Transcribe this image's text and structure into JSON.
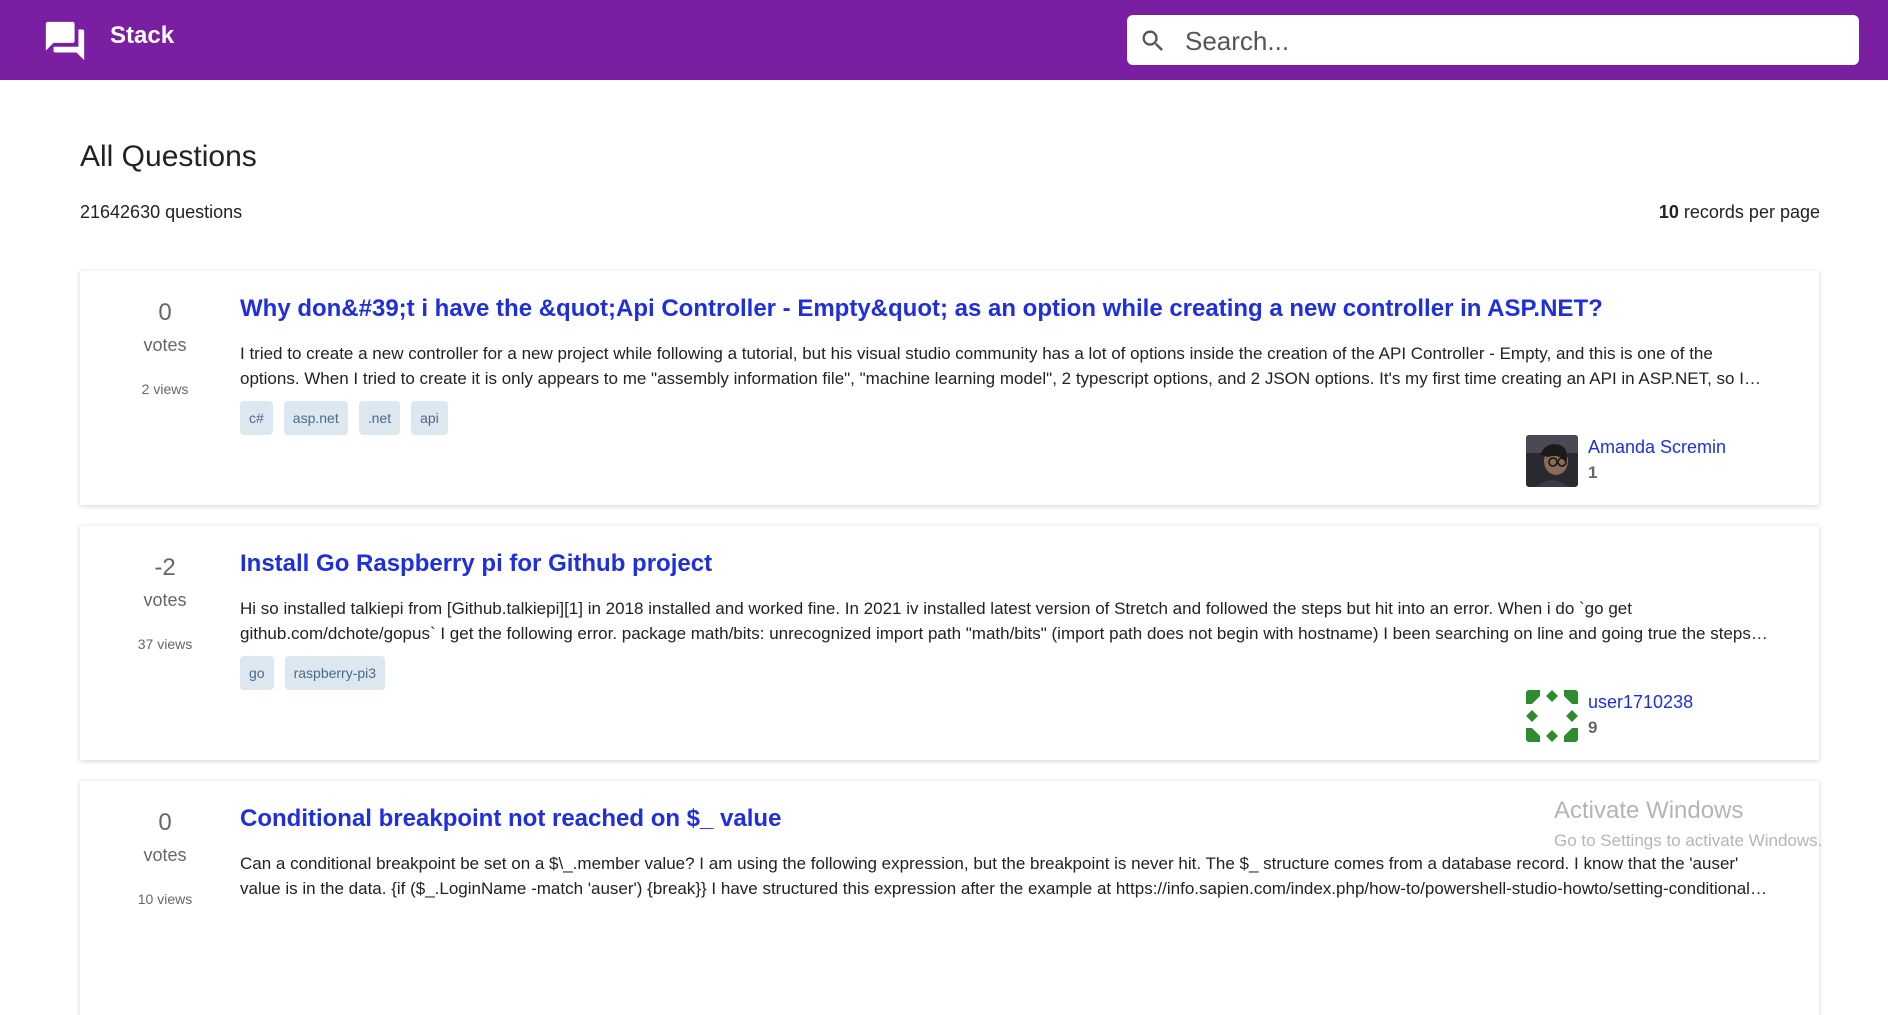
{
  "header": {
    "brand": "Stack",
    "search_placeholder": "Search..."
  },
  "main": {
    "title": "All Questions",
    "count_text": "21642630 questions",
    "per_page_value": "10",
    "per_page_suffix": " records per page"
  },
  "questions": [
    {
      "votes": "0",
      "votes_label": "votes",
      "views": "2 views",
      "title": "Why don&#39;t i have the &quot;Api Controller - Empty&quot; as an option while creating a new controller in ASP.NET?",
      "excerpt": "I tried to create a new controller for a new project while following a tutorial, but his visual studio community has a lot of options inside the creation of the API Controller - Empty, and this is one of the options. When I tried to create it is only appears to me \"assembly information file\", \"machine learning model\", 2 typescript options, and 2 JSON options. It's my first time creating an API in ASP.NET, so I don't know what to do.",
      "tags": [
        "c#",
        "asp.net",
        ".net",
        "api"
      ],
      "user": {
        "name": "Amanda Scremin",
        "reputation": "1"
      }
    },
    {
      "votes": "-2",
      "votes_label": "votes",
      "views": "37 views",
      "title": "Install Go Raspberry pi for Github project",
      "excerpt": "Hi so installed talkiepi from [Github.talkiepi][1] in 2018 installed and worked fine. In 2021 iv installed latest version of Stretch and followed the steps but hit into an error. When i do `go get github.com/dchote/gopus` I get the following error. package math/bits: unrecognized import path \"math/bits\" (import path does not begin with hostname) I been searching on line and going true the steps again and again.",
      "tags": [
        "go",
        "raspberry-pi3"
      ],
      "user": {
        "name": "user1710238",
        "reputation": "9"
      }
    },
    {
      "votes": "0",
      "votes_label": "votes",
      "views": "10 views",
      "title": "Conditional breakpoint not reached on $_ value",
      "excerpt": "Can a conditional breakpoint be set on a $\\_.member value? I am using the following expression, but the breakpoint is never hit. The $_ structure comes from a database record. I know that the 'auser' value is in the data. {if ($_.LoginName -match 'auser') {break}} I have structured this expression after the example at https://info.sapien.com/index.php/how-to/powershell-studio-howto/setting-conditional-breakpoints",
      "tags": [],
      "user": {
        "name": "",
        "reputation": ""
      }
    }
  ],
  "overlay": {
    "line1": "Activate Windows",
    "line2": "Go to Settings to activate Windows."
  }
}
